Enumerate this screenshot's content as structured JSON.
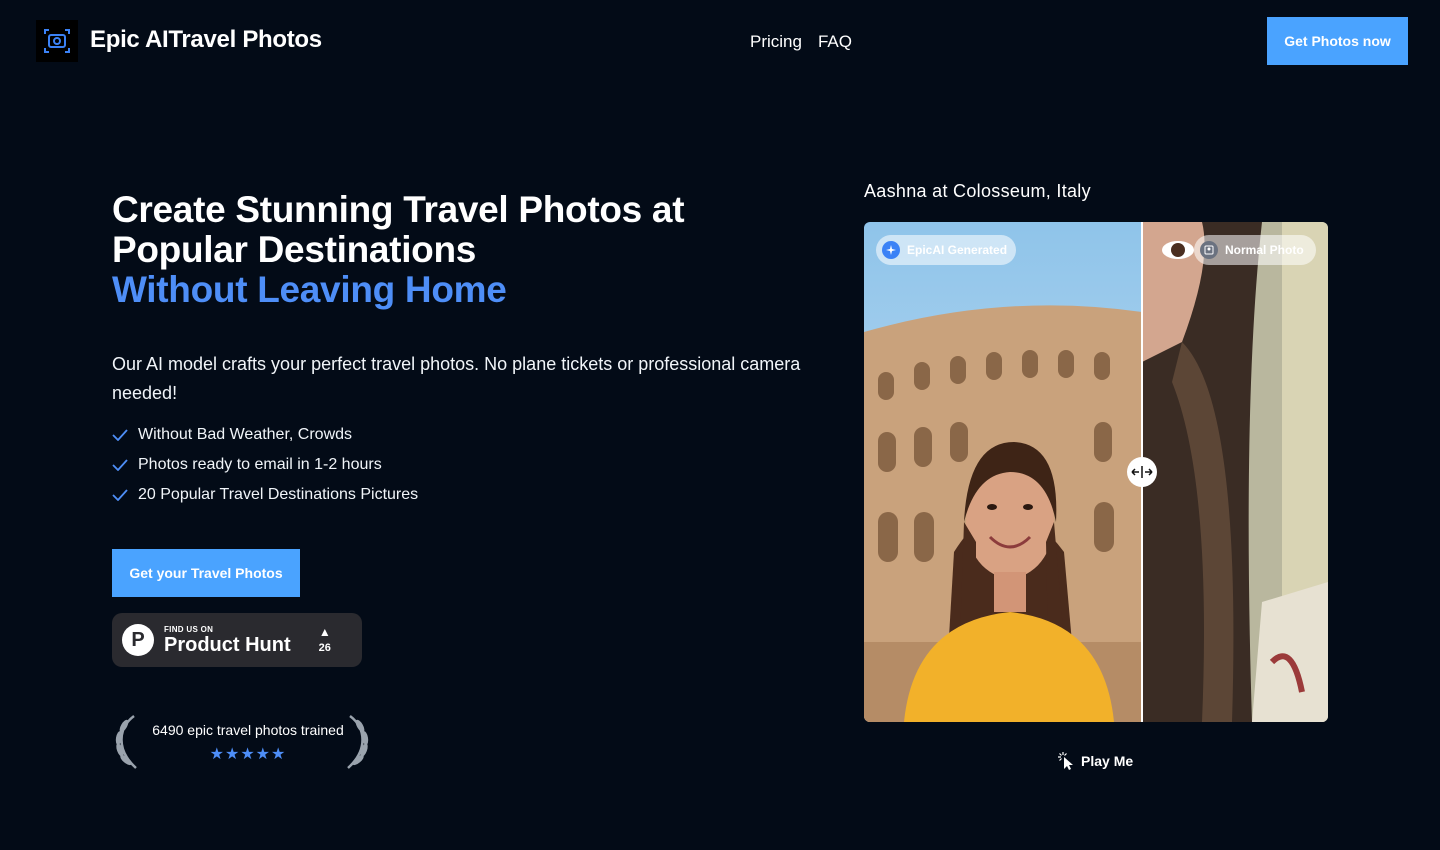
{
  "header": {
    "brand": "Epic AITravel Photos",
    "nav": [
      {
        "label": "Pricing"
      },
      {
        "label": "FAQ"
      }
    ],
    "cta_label": "Get Photos now"
  },
  "hero": {
    "headline_line1": "Create Stunning Travel Photos at",
    "headline_line2": "Popular Destinations",
    "headline_accent": "Without Leaving Home",
    "description": "Our AI model crafts your perfect travel photos. No plane tickets or professional camera needed!",
    "features": [
      "Without Bad Weather, Crowds",
      "Photos ready to email in 1-2 hours",
      "20 Popular Travel Destinations Pictures"
    ],
    "cta_label": "Get your Travel Photos",
    "product_hunt": {
      "find_us": "FIND US ON",
      "name": "Product Hunt",
      "votes": "26"
    },
    "trained_text": "6490 epic travel photos trained",
    "stars": "★★★★★"
  },
  "showcase": {
    "caption": "Aashna at Colosseum, Italy",
    "tag_ai": "EpicAI Generated",
    "tag_normal": "Normal Photo",
    "play_label": "Play Me"
  },
  "colors": {
    "background": "#030b17",
    "accent_blue": "#4e8ef7",
    "button_blue": "#4aa3ff"
  }
}
